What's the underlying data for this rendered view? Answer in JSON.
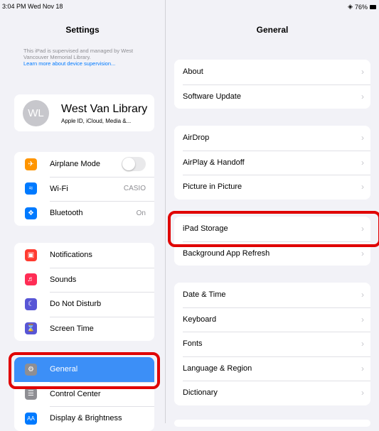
{
  "status_bar": {
    "time": "3:04 PM  Wed Nov 18",
    "battery": "76%"
  },
  "left": {
    "title": "Settings",
    "supervision": {
      "text": "This iPad is supervised and managed by West Vancouver Memorial Library.",
      "link": "Learn more about device supervision..."
    },
    "profile": {
      "initials": "WL",
      "name": "West Van Library",
      "subtitle": "Apple ID, iCloud, Media &..."
    },
    "group1": [
      {
        "label": "Airplane Mode",
        "icon": "airplane-icon",
        "color": "#ff9500",
        "toggle": false
      },
      {
        "label": "Wi-Fi",
        "icon": "wifi-icon",
        "color": "#007aff",
        "value": "CASIO"
      },
      {
        "label": "Bluetooth",
        "icon": "bluetooth-icon",
        "color": "#007aff",
        "value": "On"
      }
    ],
    "group2": [
      {
        "label": "Notifications",
        "icon": "notifications-icon",
        "color": "#ff3b30"
      },
      {
        "label": "Sounds",
        "icon": "sounds-icon",
        "color": "#ff2d55"
      },
      {
        "label": "Do Not Disturb",
        "icon": "moon-icon",
        "color": "#5856d6"
      },
      {
        "label": "Screen Time",
        "icon": "hourglass-icon",
        "color": "#5856d6"
      }
    ],
    "group3": [
      {
        "label": "General",
        "icon": "gear-icon",
        "color": "#8e8e93",
        "selected": true
      },
      {
        "label": "Control Center",
        "icon": "control-center-icon",
        "color": "#8e8e93"
      },
      {
        "label": "Display & Brightness",
        "icon": "display-icon",
        "color": "#007aff"
      }
    ]
  },
  "right": {
    "title": "General",
    "group1": [
      "About",
      "Software Update"
    ],
    "group2": [
      "AirDrop",
      "AirPlay & Handoff",
      "Picture in Picture"
    ],
    "group3": [
      "iPad Storage",
      "Background App Refresh"
    ],
    "group4": [
      "Date & Time",
      "Keyboard",
      "Fonts",
      "Language & Region",
      "Dictionary"
    ]
  },
  "accent_colors": {
    "selection": "#3c8ff7",
    "highlight_border": "#e00000",
    "link": "#007aff"
  }
}
